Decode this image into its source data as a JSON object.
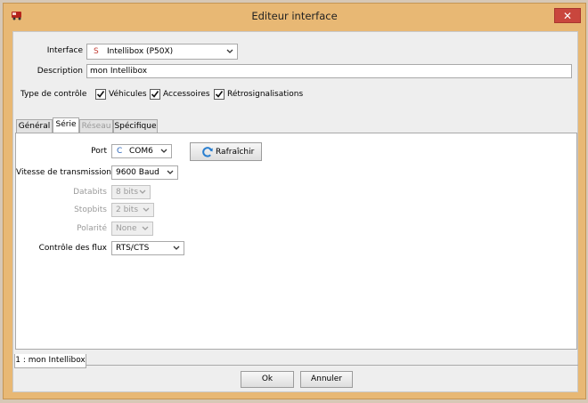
{
  "window": {
    "title": "Editeur interface",
    "close_glyph": "✕"
  },
  "interface": {
    "label": "Interface",
    "icon_letter": "S",
    "value": "Intellibox (P50X)"
  },
  "description": {
    "label": "Description",
    "value": "mon Intellibox"
  },
  "control_type": {
    "label": "Type de contrôle",
    "items": [
      {
        "label": "Véhicules",
        "checked": true
      },
      {
        "label": "Accessoires",
        "checked": true
      },
      {
        "label": "Rétrosignalisations",
        "checked": true
      }
    ]
  },
  "tabs": [
    {
      "label": "Général",
      "active": false,
      "enabled": true
    },
    {
      "label": "Série",
      "active": true,
      "enabled": true
    },
    {
      "label": "Réseau",
      "active": false,
      "enabled": false
    },
    {
      "label": "Spécifique",
      "active": false,
      "enabled": true
    }
  ],
  "serial": {
    "port": {
      "label": "Port",
      "icon_letter": "C",
      "value": "COM6"
    },
    "refresh_button": "Rafraîchir",
    "baud": {
      "label": "Vitesse de transmission",
      "value": "9600 Baud"
    },
    "databits": {
      "label": "Databits",
      "value": "8 bits"
    },
    "stopbits": {
      "label": "Stopbits",
      "value": "2 bits"
    },
    "parity": {
      "label": "Polarité",
      "value": "None"
    },
    "flow": {
      "label": "Contrôle des flux",
      "value": "RTS/CTS"
    }
  },
  "bottom_tab": {
    "label": "1 : mon Intellibox"
  },
  "buttons": {
    "ok": "Ok",
    "cancel": "Annuler"
  },
  "colors": {
    "frame": "#e8b874",
    "close": "#c9463d",
    "refresh_icon": "#2a7fd0"
  }
}
